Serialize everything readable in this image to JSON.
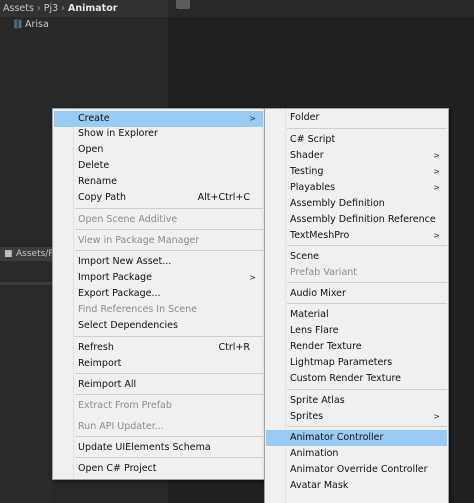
{
  "breadcrumb": [
    "Assets",
    "Pj3",
    "Animator"
  ],
  "tree": {
    "item": "Arisa"
  },
  "lower_panel": {
    "label": "Assets/P"
  },
  "main_menu": [
    {
      "label": "Create",
      "arrow": ">",
      "highlight": true
    },
    {
      "label": "Show in Explorer"
    },
    {
      "label": "Open"
    },
    {
      "label": "Delete"
    },
    {
      "label": "Rename"
    },
    {
      "label": "Copy Path",
      "shortcut": "Alt+Ctrl+C"
    },
    {
      "label": "Open Scene Additive",
      "disabled": true
    },
    {
      "label": "View in Package Manager",
      "disabled": true
    },
    {
      "label": "Import New Asset..."
    },
    {
      "label": "Import Package",
      "arrow": ">"
    },
    {
      "label": "Export Package..."
    },
    {
      "label": "Find References In Scene",
      "disabled": true
    },
    {
      "label": "Select Dependencies"
    },
    {
      "label": "Refresh",
      "shortcut": "Ctrl+R"
    },
    {
      "label": "Reimport"
    },
    {
      "label": "Reimport All"
    },
    {
      "label": "Extract From Prefab",
      "disabled": true
    },
    {
      "label": "Run API Updater...",
      "disabled": true
    },
    {
      "label": "Update UIElements Schema"
    },
    {
      "label": "Open C# Project"
    }
  ],
  "sub_menu": [
    {
      "label": "Folder"
    },
    {
      "label": "C# Script"
    },
    {
      "label": "Shader",
      "arrow": ">"
    },
    {
      "label": "Testing",
      "arrow": ">"
    },
    {
      "label": "Playables",
      "arrow": ">"
    },
    {
      "label": "Assembly Definition"
    },
    {
      "label": "Assembly Definition Reference"
    },
    {
      "label": "TextMeshPro",
      "arrow": ">"
    },
    {
      "label": "Scene"
    },
    {
      "label": "Prefab Variant",
      "disabled": true
    },
    {
      "label": "Audio Mixer"
    },
    {
      "label": "Material"
    },
    {
      "label": "Lens Flare"
    },
    {
      "label": "Render Texture"
    },
    {
      "label": "Lightmap Parameters"
    },
    {
      "label": "Custom Render Texture"
    },
    {
      "label": "Sprite Atlas"
    },
    {
      "label": "Sprites",
      "arrow": ">"
    },
    {
      "label": "Animator Controller",
      "highlight": true
    },
    {
      "label": "Animation"
    },
    {
      "label": "Animator Override Controller"
    },
    {
      "label": "Avatar Mask"
    }
  ],
  "colors": {
    "menu_bg": "#f0f0f0",
    "highlight": "#99ccf4",
    "disabled_text": "#8c8c8c",
    "editor_bg": "#282828"
  }
}
